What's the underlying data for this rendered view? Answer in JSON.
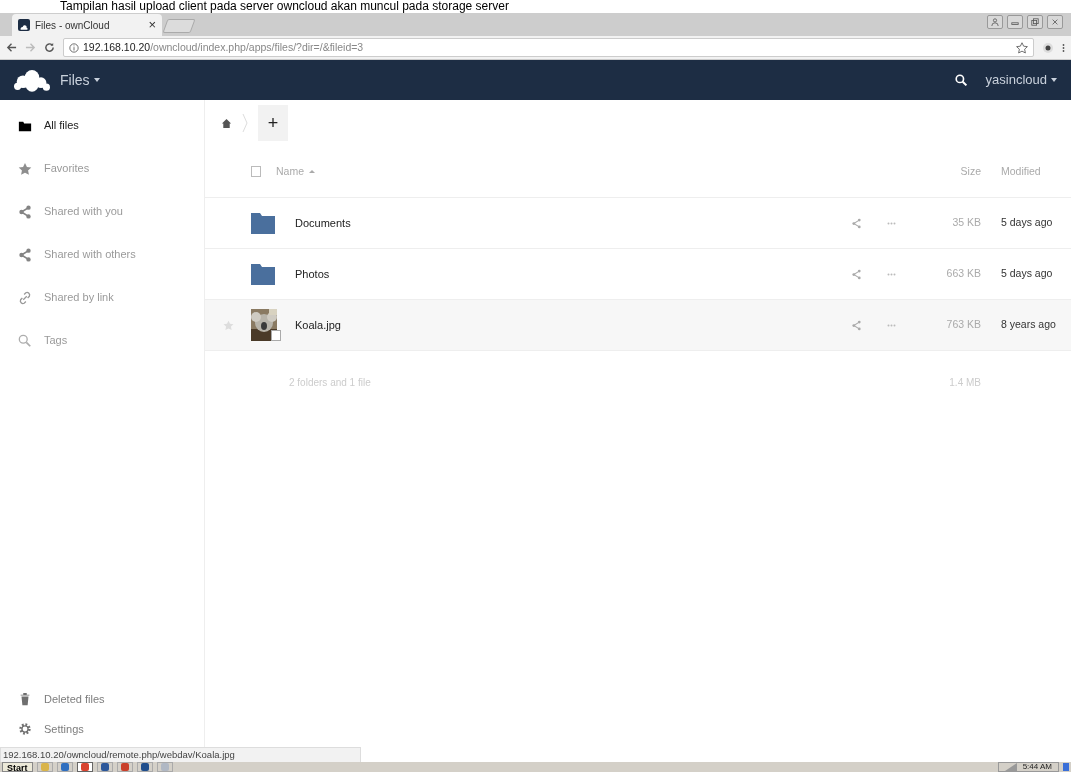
{
  "caption": "Tampilan hasil upload client pada server owncloud akan muncul pada storage server",
  "browser": {
    "tab_title": "Files - ownCloud",
    "tab_close": "×",
    "url_host": "192.168.10.20",
    "url_path": "/owncloud/index.php/apps/files/?dir=/&fileid=3",
    "status_url": "192.168.10.20/owncloud/remote.php/webdav/Koala.jpg"
  },
  "app_header": {
    "app": "Files",
    "user": "yasincloud"
  },
  "sidebar": {
    "items": [
      {
        "label": "All files",
        "kind": "folder",
        "selected": true
      },
      {
        "label": "Favorites",
        "kind": "star",
        "selected": false
      },
      {
        "label": "Shared with you",
        "kind": "share",
        "selected": false
      },
      {
        "label": "Shared with others",
        "kind": "share",
        "selected": false
      },
      {
        "label": "Shared by link",
        "kind": "link",
        "selected": false
      },
      {
        "label": "Tags",
        "kind": "search",
        "selected": false
      }
    ],
    "bottom": [
      {
        "label": "Deleted files",
        "kind": "trash"
      },
      {
        "label": "Settings",
        "kind": "gear"
      }
    ]
  },
  "toolbar": {
    "new": "+"
  },
  "table": {
    "columns": [
      "Name",
      "Size",
      "Modified"
    ],
    "select_all_checked": false,
    "rows": [
      {
        "name": "Documents",
        "kind": "folder",
        "size": "35 KB",
        "modified": "5 days ago",
        "hovered": false
      },
      {
        "name": "Photos",
        "kind": "folder",
        "size": "663 KB",
        "modified": "5 days ago",
        "hovered": false
      },
      {
        "name": "Koala.jpg",
        "size": "763 KB",
        "modified": "8 years ago",
        "hovered": true
      }
    ],
    "summary": {
      "text": "2 folders and 1 file",
      "size": "1.4 MB"
    }
  },
  "taskbar": {
    "start": "Start",
    "apps": [
      {
        "color": "#d9b44a",
        "selected": false
      },
      {
        "color": "#2f6fc0",
        "selected": false
      },
      {
        "color": "#d8432f",
        "selected": true
      },
      {
        "color": "#2b579a",
        "selected": false
      },
      {
        "color": "#c9402b",
        "selected": false
      },
      {
        "color": "#1f4e8c",
        "selected": false
      },
      {
        "color": "#b0b8c4",
        "selected": false
      }
    ],
    "clock": "5:44 AM"
  }
}
